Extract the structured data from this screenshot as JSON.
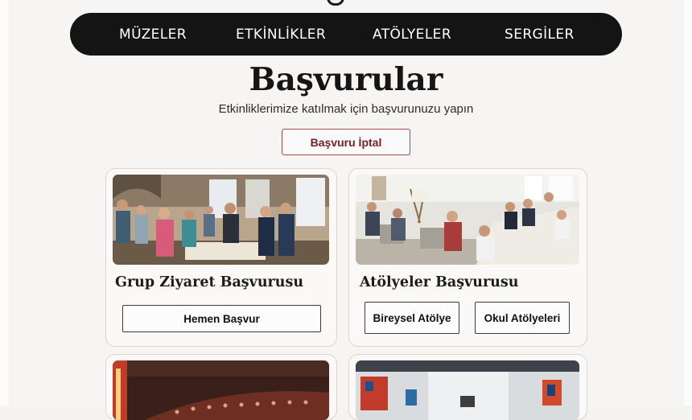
{
  "nav": {
    "items": [
      "MÜZELER",
      "ETKİNLİKLER",
      "ATÖLYELER",
      "SERGİLER"
    ]
  },
  "page": {
    "title": "Başvurular",
    "subtitle": "Etkinliklerimize katılmak için başvurunuzu yapın",
    "cancel_label": "Başvuru İptal"
  },
  "cards": [
    {
      "title": "Grup Ziyaret Başvurusu",
      "image": "group-visit-photo",
      "buttons": [
        "Hemen Başvur"
      ]
    },
    {
      "title": "Atölyeler Başvurusu",
      "image": "workshop-photo",
      "buttons": [
        "Bireysel Atölye",
        "Okul Atölyeleri"
      ]
    },
    {
      "image": "auditorium-photo"
    },
    {
      "image": "gallery-photo"
    }
  ],
  "colors": {
    "nav_bg": "#141414",
    "cancel_text": "#7a2020",
    "cancel_border": "#a44a4a",
    "card_border": "#e2d3c6"
  }
}
